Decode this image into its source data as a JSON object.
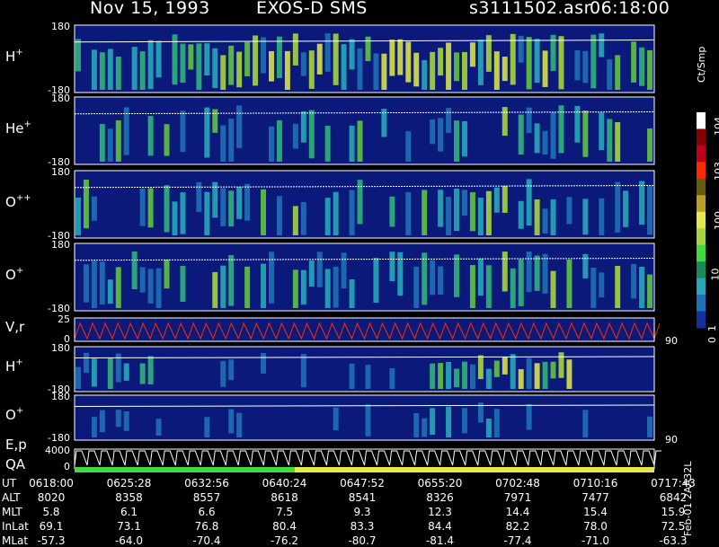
{
  "header": {
    "date": "Nov 15, 1993",
    "mission": "EXOS-D SMS",
    "file": "s3111502.asr",
    "time": "06:18:00"
  },
  "colors": {
    "background": "#000000",
    "low": "#0b1a7a",
    "mid": "#2fb27b",
    "high": "#d7e14a",
    "accent": "#ff2a00"
  },
  "chart_data": {
    "type": "heatmap",
    "title": "Nov 15, 1993   EXOS-D SMS",
    "colorbar": {
      "unit": "Ct/Smp",
      "scale": "log",
      "ticks": [
        "10^4",
        "10^3",
        "100",
        "10",
        "1",
        "0"
      ]
    },
    "panels": [
      {
        "label": "H",
        "charge": "+",
        "ylim": [
          -180,
          180
        ],
        "ticks": [
          "180",
          "-180"
        ]
      },
      {
        "label": "He",
        "charge": "+",
        "ylim": [
          -180,
          180
        ],
        "ticks": [
          "180",
          "-180"
        ]
      },
      {
        "label": "O",
        "charge": "++",
        "ylim": [
          -180,
          180
        ],
        "ticks": [
          "180",
          "-180"
        ]
      },
      {
        "label": "O",
        "charge": "+",
        "ylim": [
          -180,
          180
        ],
        "ticks": [
          "180",
          "-180"
        ]
      },
      {
        "label": "V,r",
        "charge": "",
        "ylim": [
          0,
          25
        ],
        "ticks": [
          "25",
          "0"
        ],
        "right_tick": "90"
      },
      {
        "label": "H",
        "charge": "+",
        "ylim": [
          -180,
          180
        ],
        "ticks": [
          "180",
          "-180"
        ]
      },
      {
        "label": "O",
        "charge": "+",
        "ylim": [
          -180,
          180
        ],
        "ticks": [
          "180",
          "-180"
        ],
        "right_tick": "90"
      },
      {
        "label": "E,p",
        "label2": "QA",
        "charge": "",
        "ylim": [
          0,
          4000
        ],
        "ticks": [
          "4000",
          "0"
        ]
      }
    ],
    "footer": {
      "rows": [
        {
          "name": "UT",
          "values": [
            "0618:00",
            "0625:28",
            "0632:56",
            "0640:24",
            "0647:52",
            "0655:20",
            "0702:48",
            "0710:16",
            "0717:43"
          ]
        },
        {
          "name": "ALT",
          "values": [
            "8020",
            "8358",
            "8557",
            "8618",
            "8541",
            "8326",
            "7971",
            "7477",
            "6842"
          ]
        },
        {
          "name": "MLT",
          "values": [
            "5.8",
            "6.1",
            "6.6",
            "7.5",
            "9.3",
            "12.3",
            "14.4",
            "15.4",
            "15.9"
          ]
        },
        {
          "name": "InLat",
          "values": [
            "69.1",
            "73.1",
            "76.8",
            "80.4",
            "83.3",
            "84.4",
            "82.2",
            "78.0",
            "72.5"
          ]
        },
        {
          "name": "MLat",
          "values": [
            "-57.3",
            "-64.0",
            "-70.4",
            "-76.2",
            "-80.7",
            "-81.4",
            "-77.4",
            "-71.0",
            "-63.3"
          ]
        }
      ],
      "side_note": "Feb-01  2AA32L"
    }
  }
}
